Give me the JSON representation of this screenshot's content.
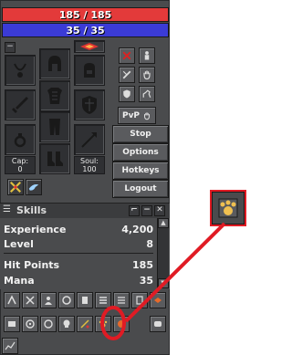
{
  "status": {
    "health": "185 / 185",
    "mana": "35 / 35"
  },
  "inventory": {
    "cap_label": "Cap:",
    "cap_value": "0",
    "soul_label": "Soul:",
    "soul_value": "100"
  },
  "buttons": {
    "pvp": "PvP",
    "stop": "Stop",
    "options": "Options",
    "hotkeys": "Hotkeys",
    "logout": "Logout"
  },
  "skills": {
    "title": "Skills",
    "rows": [
      {
        "label": "Experience",
        "value": "4,200"
      },
      {
        "label": "Level",
        "value": "8"
      },
      {
        "label": "Hit Points",
        "value": "185"
      },
      {
        "label": "Mana",
        "value": "35"
      }
    ]
  },
  "colors": {
    "health": "#e33a3a",
    "mana": "#3b3bd6",
    "highlight": "#e01b24"
  }
}
